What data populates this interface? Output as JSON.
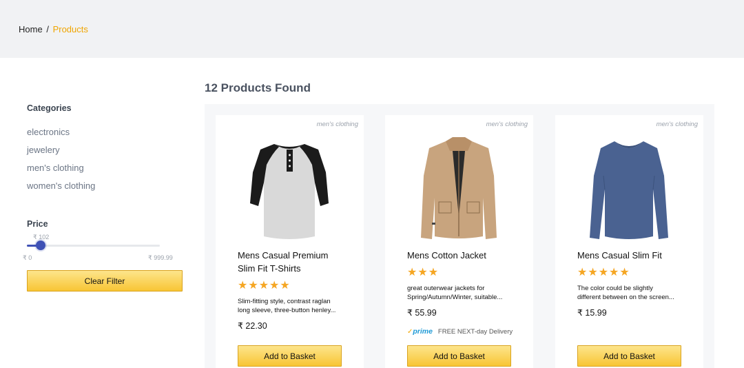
{
  "breadcrumb": {
    "home": "Home",
    "separator": "/",
    "current": "Products"
  },
  "accent_color": "#f0a500",
  "sidebar": {
    "categories_heading": "Categories",
    "categories": [
      "electronics",
      "jewelery",
      "men's clothing",
      "women's clothing"
    ],
    "price_heading": "Price",
    "price_current": "₹ 102",
    "price_current_value": 102,
    "price_min": "₹ 0",
    "price_max": "₹ 999.99",
    "price_max_value": 999.99,
    "clear_filter": "Clear Filter"
  },
  "results": {
    "title": "12 Products Found"
  },
  "products": [
    {
      "category": "men's clothing",
      "name": "Mens Casual Premium Slim Fit T-Shirts",
      "rating_stars": 5,
      "stars": "★★★★★",
      "description_lines": [
        "Slim-fitting style, contrast raglan",
        "long sleeve, three-button henley..."
      ],
      "price": "₹ 22.30",
      "prime": false,
      "button": "Add to Basket",
      "image_icon": "raglan-henley-shirt-image"
    },
    {
      "category": "men's clothing",
      "name": "Mens Cotton Jacket",
      "rating_stars": 3,
      "stars": "★★★",
      "description_lines": [
        "great outerwear jackets for",
        "Spring/Autumn/Winter, suitable..."
      ],
      "price": "₹ 55.99",
      "prime": true,
      "prime_logo": "prime",
      "prime_text": "FREE NEXT-day Delivery",
      "button": "Add to Basket",
      "image_icon": "khaki-jacket-image"
    },
    {
      "category": "men's clothing",
      "name": "Mens Casual Slim Fit",
      "rating_stars": 5,
      "stars": "★★★★★",
      "description_lines": [
        "The color could be slightly",
        "different between on the screen..."
      ],
      "price": "₹ 15.99",
      "prime": false,
      "button": "Add to Basket",
      "image_icon": "blue-longsleeve-tee-image"
    }
  ]
}
